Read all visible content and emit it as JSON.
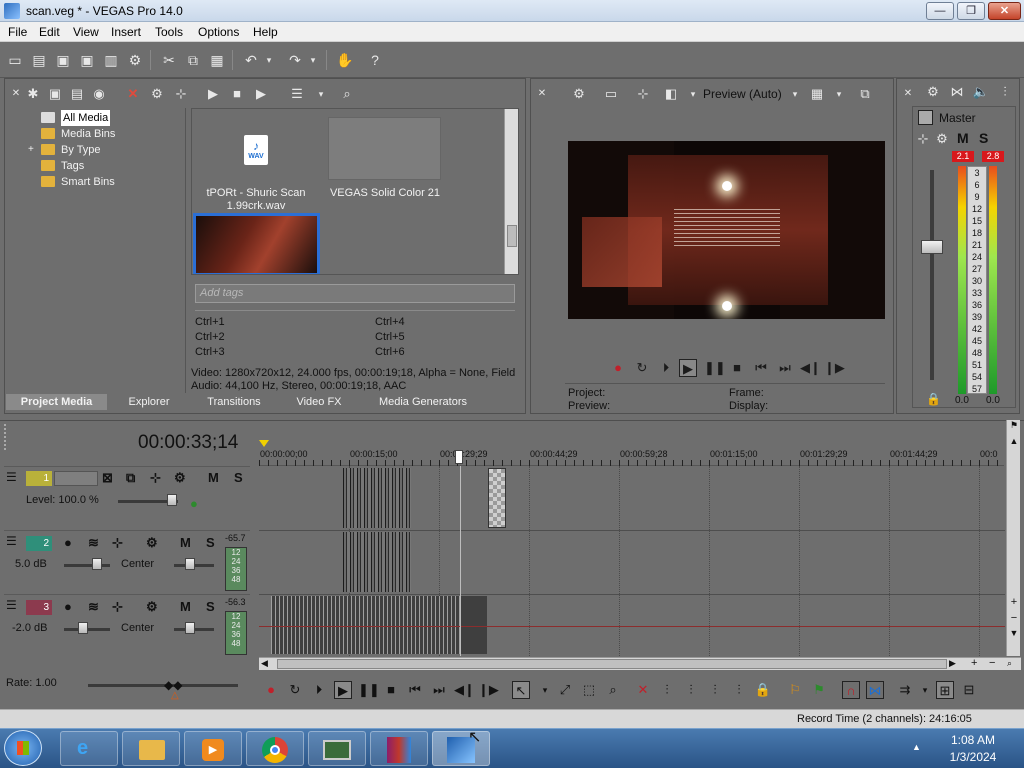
{
  "window": {
    "title": "scan.veg * - VEGAS Pro 14.0",
    "minimize": "—",
    "maximize": "❐",
    "close": "✕"
  },
  "menu": [
    "File",
    "Edit",
    "View",
    "Insert",
    "Tools",
    "Options",
    "Help"
  ],
  "project_media": {
    "tree": [
      "All Media",
      "Media Bins",
      "By Type",
      "Tags",
      "Smart Bins"
    ],
    "expand_glyph": "+",
    "items": [
      {
        "name": "tPORt - Shuric Scan 1.99crk.wav",
        "badge": "WAV"
      },
      {
        "name": "VEGAS Solid Color 21"
      }
    ],
    "tag_placeholder": "Add tags",
    "shortcuts": [
      "Ctrl+1",
      "Ctrl+2",
      "Ctrl+3",
      "Ctrl+4",
      "Ctrl+5",
      "Ctrl+6"
    ],
    "info_video": "Video: 1280x720x12, 24.000 fps, 00:00:19;18, Alpha = None, Field",
    "info_audio": "Audio: 44,100 Hz, Stereo, 00:00:19;18, AAC"
  },
  "tabs": [
    "Project Media",
    "Explorer",
    "Transitions",
    "Video FX",
    "Media Generators"
  ],
  "preview": {
    "quality": "Preview (Auto)",
    "labels": {
      "project": "Project:",
      "preview": "Preview:",
      "frame": "Frame:",
      "display": "Display:"
    }
  },
  "master": {
    "title": "Master",
    "m": "M",
    "s": "S",
    "peak_left": "2.1",
    "peak_right": "2.8",
    "scale": [
      "3",
      "6",
      "9",
      "12",
      "15",
      "18",
      "21",
      "24",
      "27",
      "30",
      "33",
      "36",
      "39",
      "42",
      "45",
      "48",
      "51",
      "54",
      "57"
    ],
    "bottom_left": "0.0",
    "bottom_right": "0.0"
  },
  "timeline": {
    "timecode": "00:00:33;14",
    "ruler": [
      "00:00:00;00",
      "00:00:15;00",
      "00:00:29;29",
      "00:00:44;29",
      "00:00:59;28",
      "00:01:15;00",
      "00:01:29;29",
      "00:01:44;29",
      "00:0"
    ],
    "tracks": [
      {
        "num": "1",
        "level_label": "Level: 100.0 %",
        "m": "M",
        "s": "S",
        "color": "#b9b13a"
      },
      {
        "num": "2",
        "vol": "5.0 dB",
        "pan": "Center",
        "m": "M",
        "s": "S",
        "peak": "-65.7",
        "color": "#2f8f7a"
      },
      {
        "num": "3",
        "vol": "-2.0 dB",
        "pan": "Center",
        "m": "M",
        "s": "S",
        "peak": "-56.3",
        "color": "#8c3a4e"
      }
    ],
    "mini_scale": [
      "12",
      "24",
      "36",
      "48"
    ],
    "rate": "Rate: 1.00"
  },
  "status": {
    "record_time": "Record Time (2 channels): 24:16:05"
  },
  "taskbar": {
    "time": "1:08 AM",
    "date": "1/3/2024"
  }
}
